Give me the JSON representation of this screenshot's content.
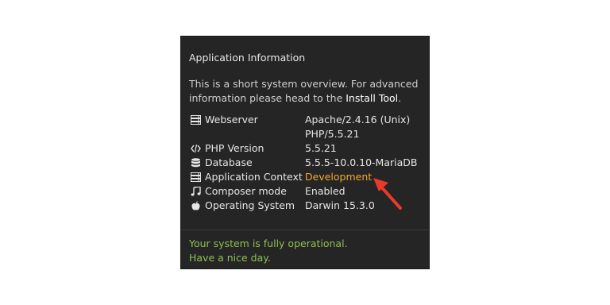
{
  "panel": {
    "title": "Application Information",
    "intro_text": "This is a short system overview. For advanced information please head to the ",
    "intro_link": "Install Tool",
    "intro_end": "."
  },
  "rows": [
    {
      "icon": "server-icon",
      "label": "Webserver",
      "value_line1": "Apache/2.4.16 (Unix)",
      "value_line2": "PHP/5.5.21"
    },
    {
      "icon": "code-icon",
      "label": "PHP Version",
      "value": "5.5.21"
    },
    {
      "icon": "database-icon",
      "label": "Database",
      "value": "5.5.5-10.0.10-MariaDB"
    },
    {
      "icon": "server-icon",
      "label": "Application Context",
      "value": "Development"
    },
    {
      "icon": "music-note-icon",
      "label": "Composer mode",
      "value": "Enabled"
    },
    {
      "icon": "apple-icon",
      "label": "Operating System",
      "value": "Darwin 15.3.0"
    }
  ],
  "status": {
    "line1": "Your system is fully operational.",
    "line2": "Have a nice day."
  },
  "colors": {
    "panel_bg": "#252525",
    "warning": "#f2a732",
    "success": "#8cc152",
    "annotation_arrow": "#e8392c"
  }
}
